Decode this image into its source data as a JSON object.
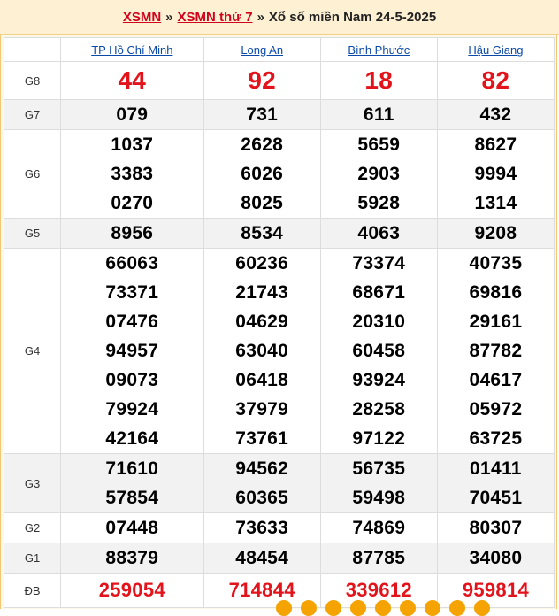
{
  "header": {
    "crumb1": "XSMN",
    "crumb2": "XSMN thứ 7",
    "separator": "»",
    "title": "Xổ số miền Nam 24-5-2025"
  },
  "provinces": [
    "TP Hồ Chí Minh",
    "Long An",
    "Bình Phước",
    "Hậu Giang"
  ],
  "prizes": [
    {
      "label": "G8",
      "values": [
        [
          "44"
        ],
        [
          "92"
        ],
        [
          "18"
        ],
        [
          "82"
        ]
      ]
    },
    {
      "label": "G7",
      "values": [
        [
          "079"
        ],
        [
          "731"
        ],
        [
          "611"
        ],
        [
          "432"
        ]
      ]
    },
    {
      "label": "G6",
      "values": [
        [
          "1037",
          "3383",
          "0270"
        ],
        [
          "2628",
          "6026",
          "8025"
        ],
        [
          "5659",
          "2903",
          "5928"
        ],
        [
          "8627",
          "9994",
          "1314"
        ]
      ]
    },
    {
      "label": "G5",
      "values": [
        [
          "8956"
        ],
        [
          "8534"
        ],
        [
          "4063"
        ],
        [
          "9208"
        ]
      ]
    },
    {
      "label": "G4",
      "values": [
        [
          "66063",
          "73371",
          "07476",
          "94957",
          "09073",
          "79924",
          "42164"
        ],
        [
          "60236",
          "21743",
          "04629",
          "63040",
          "06418",
          "37979",
          "73761"
        ],
        [
          "73374",
          "68671",
          "20310",
          "60458",
          "93924",
          "28258",
          "97122"
        ],
        [
          "40735",
          "69816",
          "29161",
          "87782",
          "04617",
          "05972",
          "63725"
        ]
      ]
    },
    {
      "label": "G3",
      "values": [
        [
          "71610",
          "57854"
        ],
        [
          "94562",
          "60365"
        ],
        [
          "56735",
          "59498"
        ],
        [
          "01411",
          "70451"
        ]
      ]
    },
    {
      "label": "G2",
      "values": [
        [
          "07448"
        ],
        [
          "73633"
        ],
        [
          "74869"
        ],
        [
          "80307"
        ]
      ]
    },
    {
      "label": "G1",
      "values": [
        [
          "88379"
        ],
        [
          "48454"
        ],
        [
          "87785"
        ],
        [
          "34080"
        ]
      ]
    },
    {
      "label": "ĐB",
      "values": [
        [
          "259054"
        ],
        [
          "714844"
        ],
        [
          "339612"
        ],
        [
          "959814"
        ]
      ]
    }
  ],
  "colors": {
    "accent_red": "#e3131b",
    "link_blue": "#0b49a8",
    "header_bg": "#fdf0d3"
  }
}
